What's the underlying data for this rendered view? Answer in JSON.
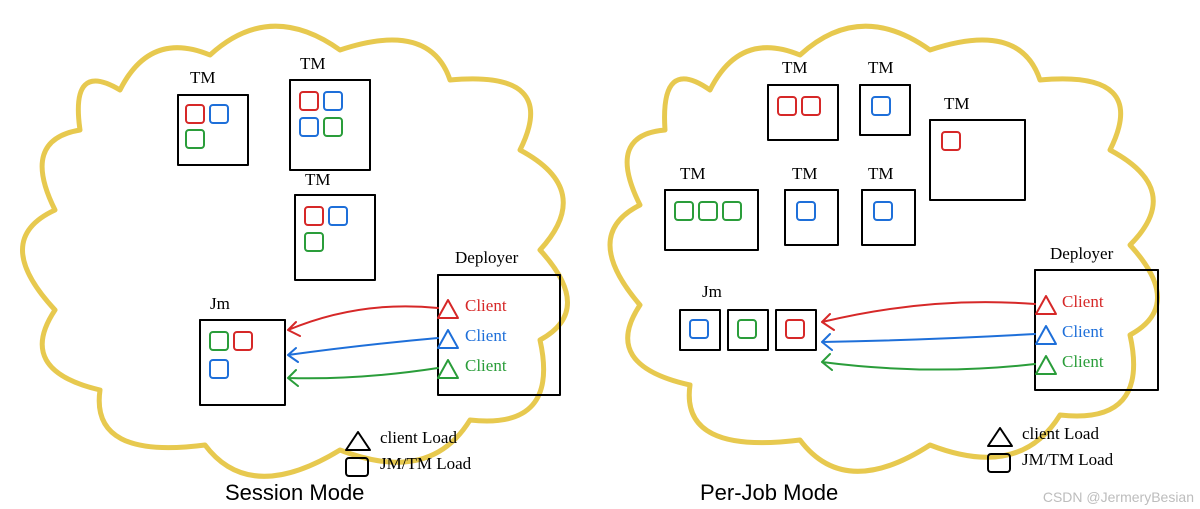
{
  "left": {
    "title": "Session Mode",
    "tm1": "TM",
    "tm2": "TM",
    "tm3": "TM",
    "jm": "Jm",
    "deployer": "Deployer",
    "client1": "Client",
    "client2": "Client",
    "client3": "Client",
    "legend1": "client Load",
    "legend2": "JM/TM Load"
  },
  "right": {
    "title": "Per-Job Mode",
    "tm1": "TM",
    "tm2": "TM",
    "tm3": "TM",
    "tm4": "TM",
    "tm5": "TM",
    "tm6": "TM",
    "jm": "Jm",
    "deployer": "Deployer",
    "client1": "Client",
    "client2": "Client",
    "client3": "Client",
    "legend1": "client Load",
    "legend2": "JM/TM Load"
  },
  "watermark": "CSDN @JermeryBesian"
}
